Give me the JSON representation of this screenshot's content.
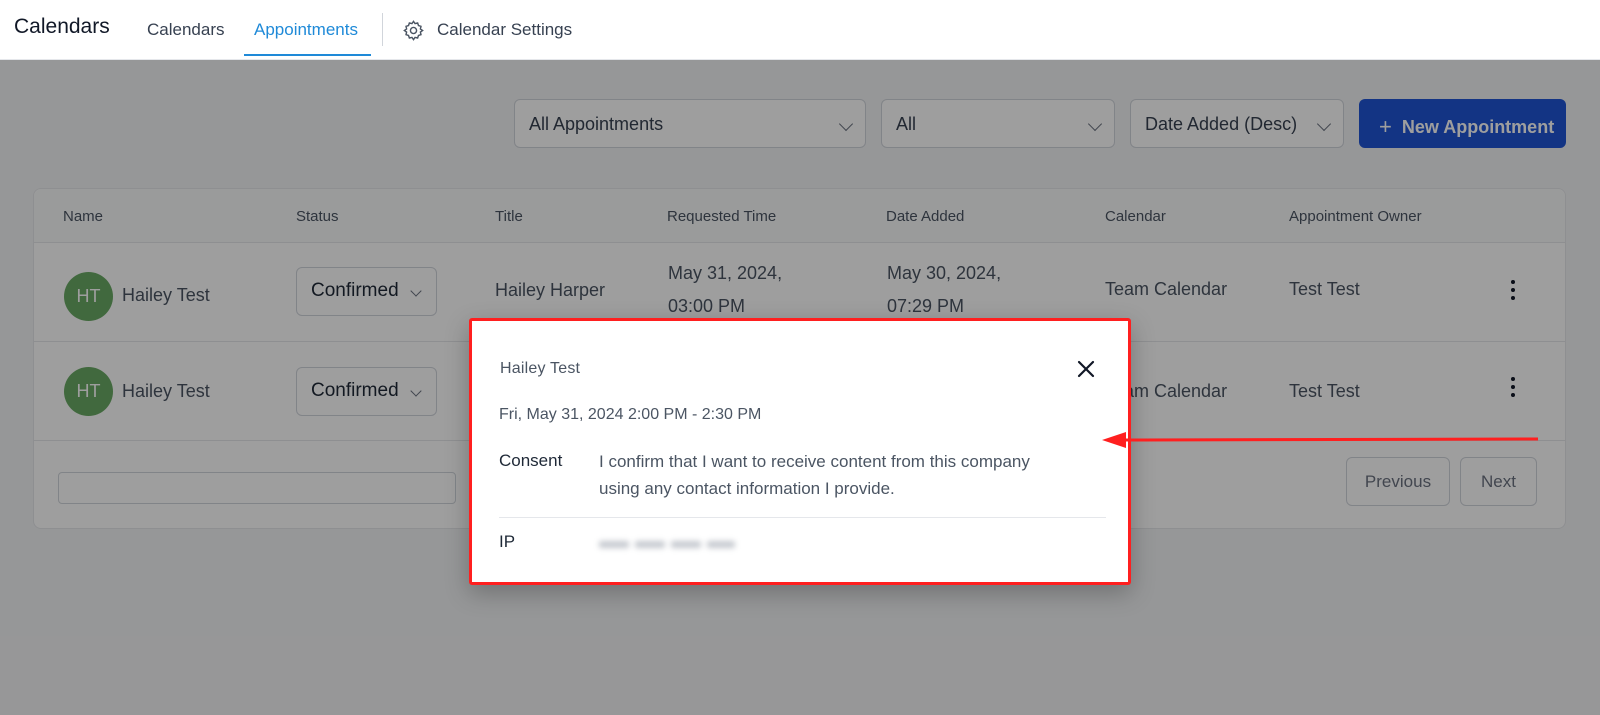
{
  "header": {
    "app_title": "Calendars",
    "tabs": [
      {
        "label": "Calendars",
        "active": false
      },
      {
        "label": "Appointments",
        "active": true
      }
    ],
    "settings_label": "Calendar Settings"
  },
  "filters": {
    "appointments_filter": "All Appointments",
    "status_filter": "All",
    "sort": "Date Added (Desc)",
    "new_button": "New Appointment"
  },
  "table": {
    "columns": [
      "Name",
      "Status",
      "Title",
      "Requested Time",
      "Date Added",
      "Calendar",
      "Appointment Owner"
    ],
    "rows": [
      {
        "initials": "HT",
        "name": "Hailey Test",
        "status": "Confirmed",
        "title": "Hailey Harper",
        "requested_line1": "May 31, 2024,",
        "requested_line2": "03:00 PM",
        "added_line1": "May 30, 2024,",
        "added_line2": "07:29 PM",
        "calendar": "Team Calendar",
        "owner": "Test Test"
      },
      {
        "initials": "HT",
        "name": "Hailey Test",
        "status": "Confirmed",
        "calendar": "Team Calendar",
        "owner": "Test Test"
      }
    ],
    "pagination": {
      "previous": "Previous",
      "next": "Next"
    }
  },
  "modal": {
    "name": "Hailey Test",
    "time": "Fri, May 31, 2024 2:00 PM - 2:30 PM",
    "consent_label": "Consent",
    "consent_line1": "I confirm that I want to receive content from this company",
    "consent_line2": "using any contact information I provide.",
    "ip_label": "IP"
  },
  "colors": {
    "accent": "#1f8ad8",
    "primary_button": "#1f55d6",
    "avatar": "#6aaa64",
    "highlight": "#ff1f1f"
  }
}
